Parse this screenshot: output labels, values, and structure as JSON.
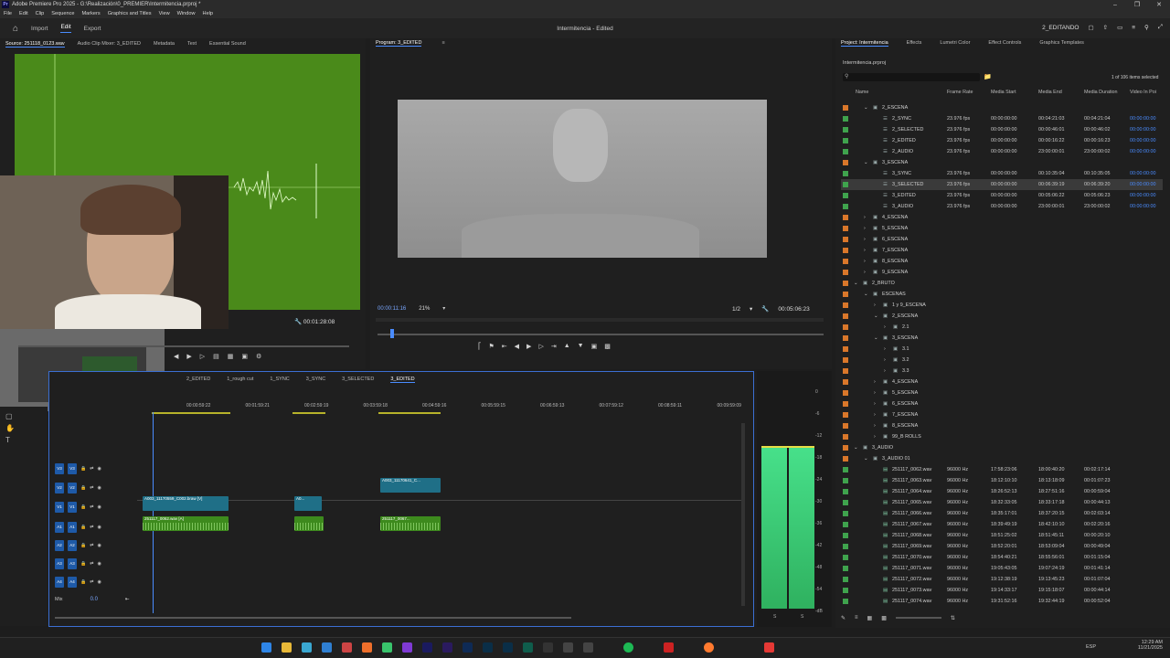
{
  "window": {
    "title": "Adobe Premiere Pro 2025 - G:\\Realización\\0_PREMIER\\Intermitencia.prproj *"
  },
  "menu": [
    "File",
    "Edit",
    "Clip",
    "Sequence",
    "Markers",
    "Graphics and Titles",
    "View",
    "Window",
    "Help"
  ],
  "header": {
    "tabs": [
      "Import",
      "Edit",
      "Export"
    ],
    "active_tab": "Edit",
    "doc_title": "Intermitencia - Edited",
    "workspace": "2_EDITANDO"
  },
  "source": {
    "tabs": [
      "Source: 251118_0123.wav",
      "Audio Clip Mixer: 3_EDITED",
      "Metadata",
      "Text",
      "Essential Sound"
    ],
    "duration": "00:01:28:08"
  },
  "program": {
    "tab": "Program: 3_EDITED",
    "timecode": "00:00:11:16",
    "zoom": "21%",
    "resolution": "1/2",
    "duration": "00:05:06:23"
  },
  "project": {
    "tabs": [
      "Project: Intermitencia",
      "Effects",
      "Lumetri Color",
      "Effect Controls",
      "Graphics Templates"
    ],
    "file": "Intermitencia.prproj",
    "count": "1 of 106 items selected",
    "columns": [
      "Name",
      "Frame Rate",
      "Media Start",
      "Media End",
      "Media Duration",
      "Video In Poi"
    ],
    "rows": [
      {
        "indent": 1,
        "type": "bin",
        "open": true,
        "name": "2_ESCENA",
        "color": "#d9772a"
      },
      {
        "indent": 2,
        "type": "seq",
        "name": "2_SYNC",
        "fps": "23.976 fps",
        "start": "00:00:00:00",
        "end": "00:04:21:03",
        "dur": "00:04:21:04",
        "vin": "00:00:00:00",
        "color": "#3fa34d"
      },
      {
        "indent": 2,
        "type": "seq",
        "name": "2_SELECTED",
        "fps": "23.976 fps",
        "start": "00:00:00:00",
        "end": "00:00:46:01",
        "dur": "00:00:46:02",
        "vin": "00:00:00:00",
        "color": "#3fa34d"
      },
      {
        "indent": 2,
        "type": "seq",
        "name": "2_EDITED",
        "fps": "23.976 fps",
        "start": "00:00:00:00",
        "end": "00:00:16:22",
        "dur": "00:00:16:23",
        "vin": "00:00:00:00",
        "color": "#3fa34d"
      },
      {
        "indent": 2,
        "type": "seq",
        "name": "2_AUDIO",
        "fps": "23.976 fps",
        "start": "00:00:00:00",
        "end": "23:00:00:01",
        "dur": "23:00:00:02",
        "vin": "00:00:00:00",
        "color": "#3fa34d"
      },
      {
        "indent": 1,
        "type": "bin",
        "open": true,
        "name": "3_ESCENA",
        "color": "#d9772a"
      },
      {
        "indent": 2,
        "type": "seq",
        "name": "3_SYNC",
        "fps": "23.976 fps",
        "start": "00:00:00:00",
        "end": "00:10:35:04",
        "dur": "00:10:35:05",
        "vin": "00:00:00:00",
        "color": "#3fa34d"
      },
      {
        "indent": 2,
        "type": "seq",
        "name": "3_SELECTED",
        "fps": "23.976 fps",
        "start": "00:00:00:00",
        "end": "00:06:39:19",
        "dur": "00:06:39:20",
        "vin": "00:00:00:00",
        "color": "#3fa34d",
        "selected": true
      },
      {
        "indent": 2,
        "type": "seq",
        "name": "3_EDITED",
        "fps": "23.976 fps",
        "start": "00:00:00:00",
        "end": "00:05:06:22",
        "dur": "00:05:06:23",
        "vin": "00:00:00:00",
        "color": "#3fa34d"
      },
      {
        "indent": 2,
        "type": "seq",
        "name": "3_AUDIO",
        "fps": "23.976 fps",
        "start": "00:00:00:00",
        "end": "23:00:00:01",
        "dur": "23:00:00:02",
        "vin": "00:00:00:00",
        "color": "#3fa34d"
      },
      {
        "indent": 1,
        "type": "bin",
        "open": false,
        "name": "4_ESCENA",
        "color": "#d9772a"
      },
      {
        "indent": 1,
        "type": "bin",
        "open": false,
        "name": "5_ESCENA",
        "color": "#d9772a"
      },
      {
        "indent": 1,
        "type": "bin",
        "open": false,
        "name": "6_ESCENA",
        "color": "#d9772a"
      },
      {
        "indent": 1,
        "type": "bin",
        "open": false,
        "name": "7_ESCENA",
        "color": "#d9772a"
      },
      {
        "indent": 1,
        "type": "bin",
        "open": false,
        "name": "8_ESCENA",
        "color": "#d9772a"
      },
      {
        "indent": 1,
        "type": "bin",
        "open": false,
        "name": "9_ESCENA",
        "color": "#d9772a"
      },
      {
        "indent": 0,
        "type": "bin",
        "open": true,
        "name": "2_BRUTO",
        "color": "#d9772a"
      },
      {
        "indent": 1,
        "type": "bin",
        "open": true,
        "name": "ESCENAS",
        "color": "#d9772a"
      },
      {
        "indent": 2,
        "type": "bin",
        "open": false,
        "name": "1 y 9_ESCENA",
        "color": "#d9772a"
      },
      {
        "indent": 2,
        "type": "bin",
        "open": true,
        "name": "2_ESCENA",
        "color": "#d9772a"
      },
      {
        "indent": 3,
        "type": "bin",
        "open": false,
        "name": "2.1",
        "color": "#d9772a"
      },
      {
        "indent": 2,
        "type": "bin",
        "open": true,
        "name": "3_ESCENA",
        "color": "#d9772a"
      },
      {
        "indent": 3,
        "type": "bin",
        "open": false,
        "name": "3.1",
        "color": "#d9772a"
      },
      {
        "indent": 3,
        "type": "bin",
        "open": false,
        "name": "3.2",
        "color": "#d9772a"
      },
      {
        "indent": 3,
        "type": "bin",
        "open": false,
        "name": "3.3",
        "color": "#d9772a"
      },
      {
        "indent": 2,
        "type": "bin",
        "open": false,
        "name": "4_ESCENA",
        "color": "#d9772a"
      },
      {
        "indent": 2,
        "type": "bin",
        "open": false,
        "name": "5_ESCENA",
        "color": "#d9772a"
      },
      {
        "indent": 2,
        "type": "bin",
        "open": false,
        "name": "6_ESCENA",
        "color": "#d9772a"
      },
      {
        "indent": 2,
        "type": "bin",
        "open": false,
        "name": "7_ESCENA",
        "color": "#d9772a"
      },
      {
        "indent": 2,
        "type": "bin",
        "open": false,
        "name": "8_ESCENA",
        "color": "#d9772a"
      },
      {
        "indent": 2,
        "type": "bin",
        "open": false,
        "name": "99_B ROLLS",
        "color": "#d9772a"
      },
      {
        "indent": 0,
        "type": "bin",
        "open": true,
        "name": "3_AUDIO",
        "color": "#d9772a"
      },
      {
        "indent": 1,
        "type": "bin",
        "open": true,
        "name": "3_AUDIO 01",
        "color": "#d9772a"
      },
      {
        "indent": 2,
        "type": "aud",
        "name": "251117_0062.wav",
        "fps": "96000 Hz",
        "start": "17:58:23:06",
        "end": "18:00:40:20",
        "dur": "00:02:17:14",
        "color": "#3fa34d"
      },
      {
        "indent": 2,
        "type": "aud",
        "name": "251117_0063.wav",
        "fps": "96000 Hz",
        "start": "18:12:10:10",
        "end": "18:13:18:09",
        "dur": "00:01:07:23",
        "color": "#3fa34d"
      },
      {
        "indent": 2,
        "type": "aud",
        "name": "251117_0064.wav",
        "fps": "96000 Hz",
        "start": "18:26:52:13",
        "end": "18:27:51:16",
        "dur": "00:00:59:04",
        "color": "#3fa34d"
      },
      {
        "indent": 2,
        "type": "aud",
        "name": "251117_0065.wav",
        "fps": "96000 Hz",
        "start": "18:32:33:05",
        "end": "18:33:17:18",
        "dur": "00:00:44:13",
        "color": "#3fa34d"
      },
      {
        "indent": 2,
        "type": "aud",
        "name": "251117_0066.wav",
        "fps": "96000 Hz",
        "start": "18:35:17:01",
        "end": "18:37:20:15",
        "dur": "00:02:03:14",
        "color": "#3fa34d"
      },
      {
        "indent": 2,
        "type": "aud",
        "name": "251117_0067.wav",
        "fps": "96000 Hz",
        "start": "18:39:49:19",
        "end": "18:42:10:10",
        "dur": "00:02:20:16",
        "color": "#3fa34d"
      },
      {
        "indent": 2,
        "type": "aud",
        "name": "251117_0068.wav",
        "fps": "96000 Hz",
        "start": "18:51:25:02",
        "end": "18:51:45:11",
        "dur": "00:00:20:10",
        "color": "#3fa34d"
      },
      {
        "indent": 2,
        "type": "aud",
        "name": "251117_0069.wav",
        "fps": "96000 Hz",
        "start": "18:52:20:01",
        "end": "18:53:09:04",
        "dur": "00:00:49:04",
        "color": "#3fa34d"
      },
      {
        "indent": 2,
        "type": "aud",
        "name": "251117_0070.wav",
        "fps": "96000 Hz",
        "start": "18:54:40:21",
        "end": "18:55:56:01",
        "dur": "00:01:15:04",
        "color": "#3fa34d"
      },
      {
        "indent": 2,
        "type": "aud",
        "name": "251117_0071.wav",
        "fps": "96000 Hz",
        "start": "19:05:43:05",
        "end": "19:07:24:19",
        "dur": "00:01:41:14",
        "color": "#3fa34d"
      },
      {
        "indent": 2,
        "type": "aud",
        "name": "251117_0072.wav",
        "fps": "96000 Hz",
        "start": "19:12:38:19",
        "end": "19:13:45:23",
        "dur": "00:01:07:04",
        "color": "#3fa34d"
      },
      {
        "indent": 2,
        "type": "aud",
        "name": "251117_0073.wav",
        "fps": "96000 Hz",
        "start": "19:14:33:17",
        "end": "19:15:18:07",
        "dur": "00:00:44:14",
        "color": "#3fa34d"
      },
      {
        "indent": 2,
        "type": "aud",
        "name": "251117_0074.wav",
        "fps": "96000 Hz",
        "start": "19:31:52:16",
        "end": "19:32:44:19",
        "dur": "00:00:52:04",
        "color": "#3fa34d"
      }
    ]
  },
  "timeline": {
    "sequence_tabs": [
      "2_EDITED",
      "1_rough cut",
      "1_SYNC",
      "3_SYNC",
      "3_SELECTED",
      "3_EDITED"
    ],
    "active_seq": "3_EDITED",
    "ruler": [
      "00:00:59:22",
      "00:01:59:21",
      "00:02:59:19",
      "00:03:59:18",
      "00:04:59:16",
      "00:05:59:15",
      "00:06:59:13",
      "00:07:59:12",
      "00:08:59:11",
      "00:09:59:09"
    ],
    "video_tracks": [
      "V3",
      "V2",
      "V1"
    ],
    "audio_tracks": [
      "A1",
      "A2",
      "A3",
      "A4"
    ],
    "mix_label": "Mix",
    "mix_value": "0.0",
    "clips": [
      {
        "track": "V2",
        "label": "A003_11170641_C..."
      },
      {
        "track": "V1",
        "label": "A003_11170559_C002.braw [V]"
      },
      {
        "track": "V1",
        "label": "A0..."
      },
      {
        "track": "A1",
        "label": "251117_0062.wav [A]"
      },
      {
        "track": "A1",
        "label": ""
      },
      {
        "track": "A1",
        "label": "251117_0067..."
      }
    ]
  },
  "meter": {
    "labels": [
      "0",
      "-6",
      "-12",
      "-18",
      "-24",
      "-30",
      "-36",
      "-42",
      "-48",
      "-54",
      "-dB"
    ],
    "footer": [
      "S",
      "S"
    ]
  },
  "taskbar": {
    "lang": "ESP",
    "time": "12:29 AM",
    "date": "11/21/2025"
  },
  "colors": {
    "accent": "#4a8cff",
    "bin": "#d9772a",
    "media": "#3fa34d",
    "waveform": "#4a8a1a"
  }
}
